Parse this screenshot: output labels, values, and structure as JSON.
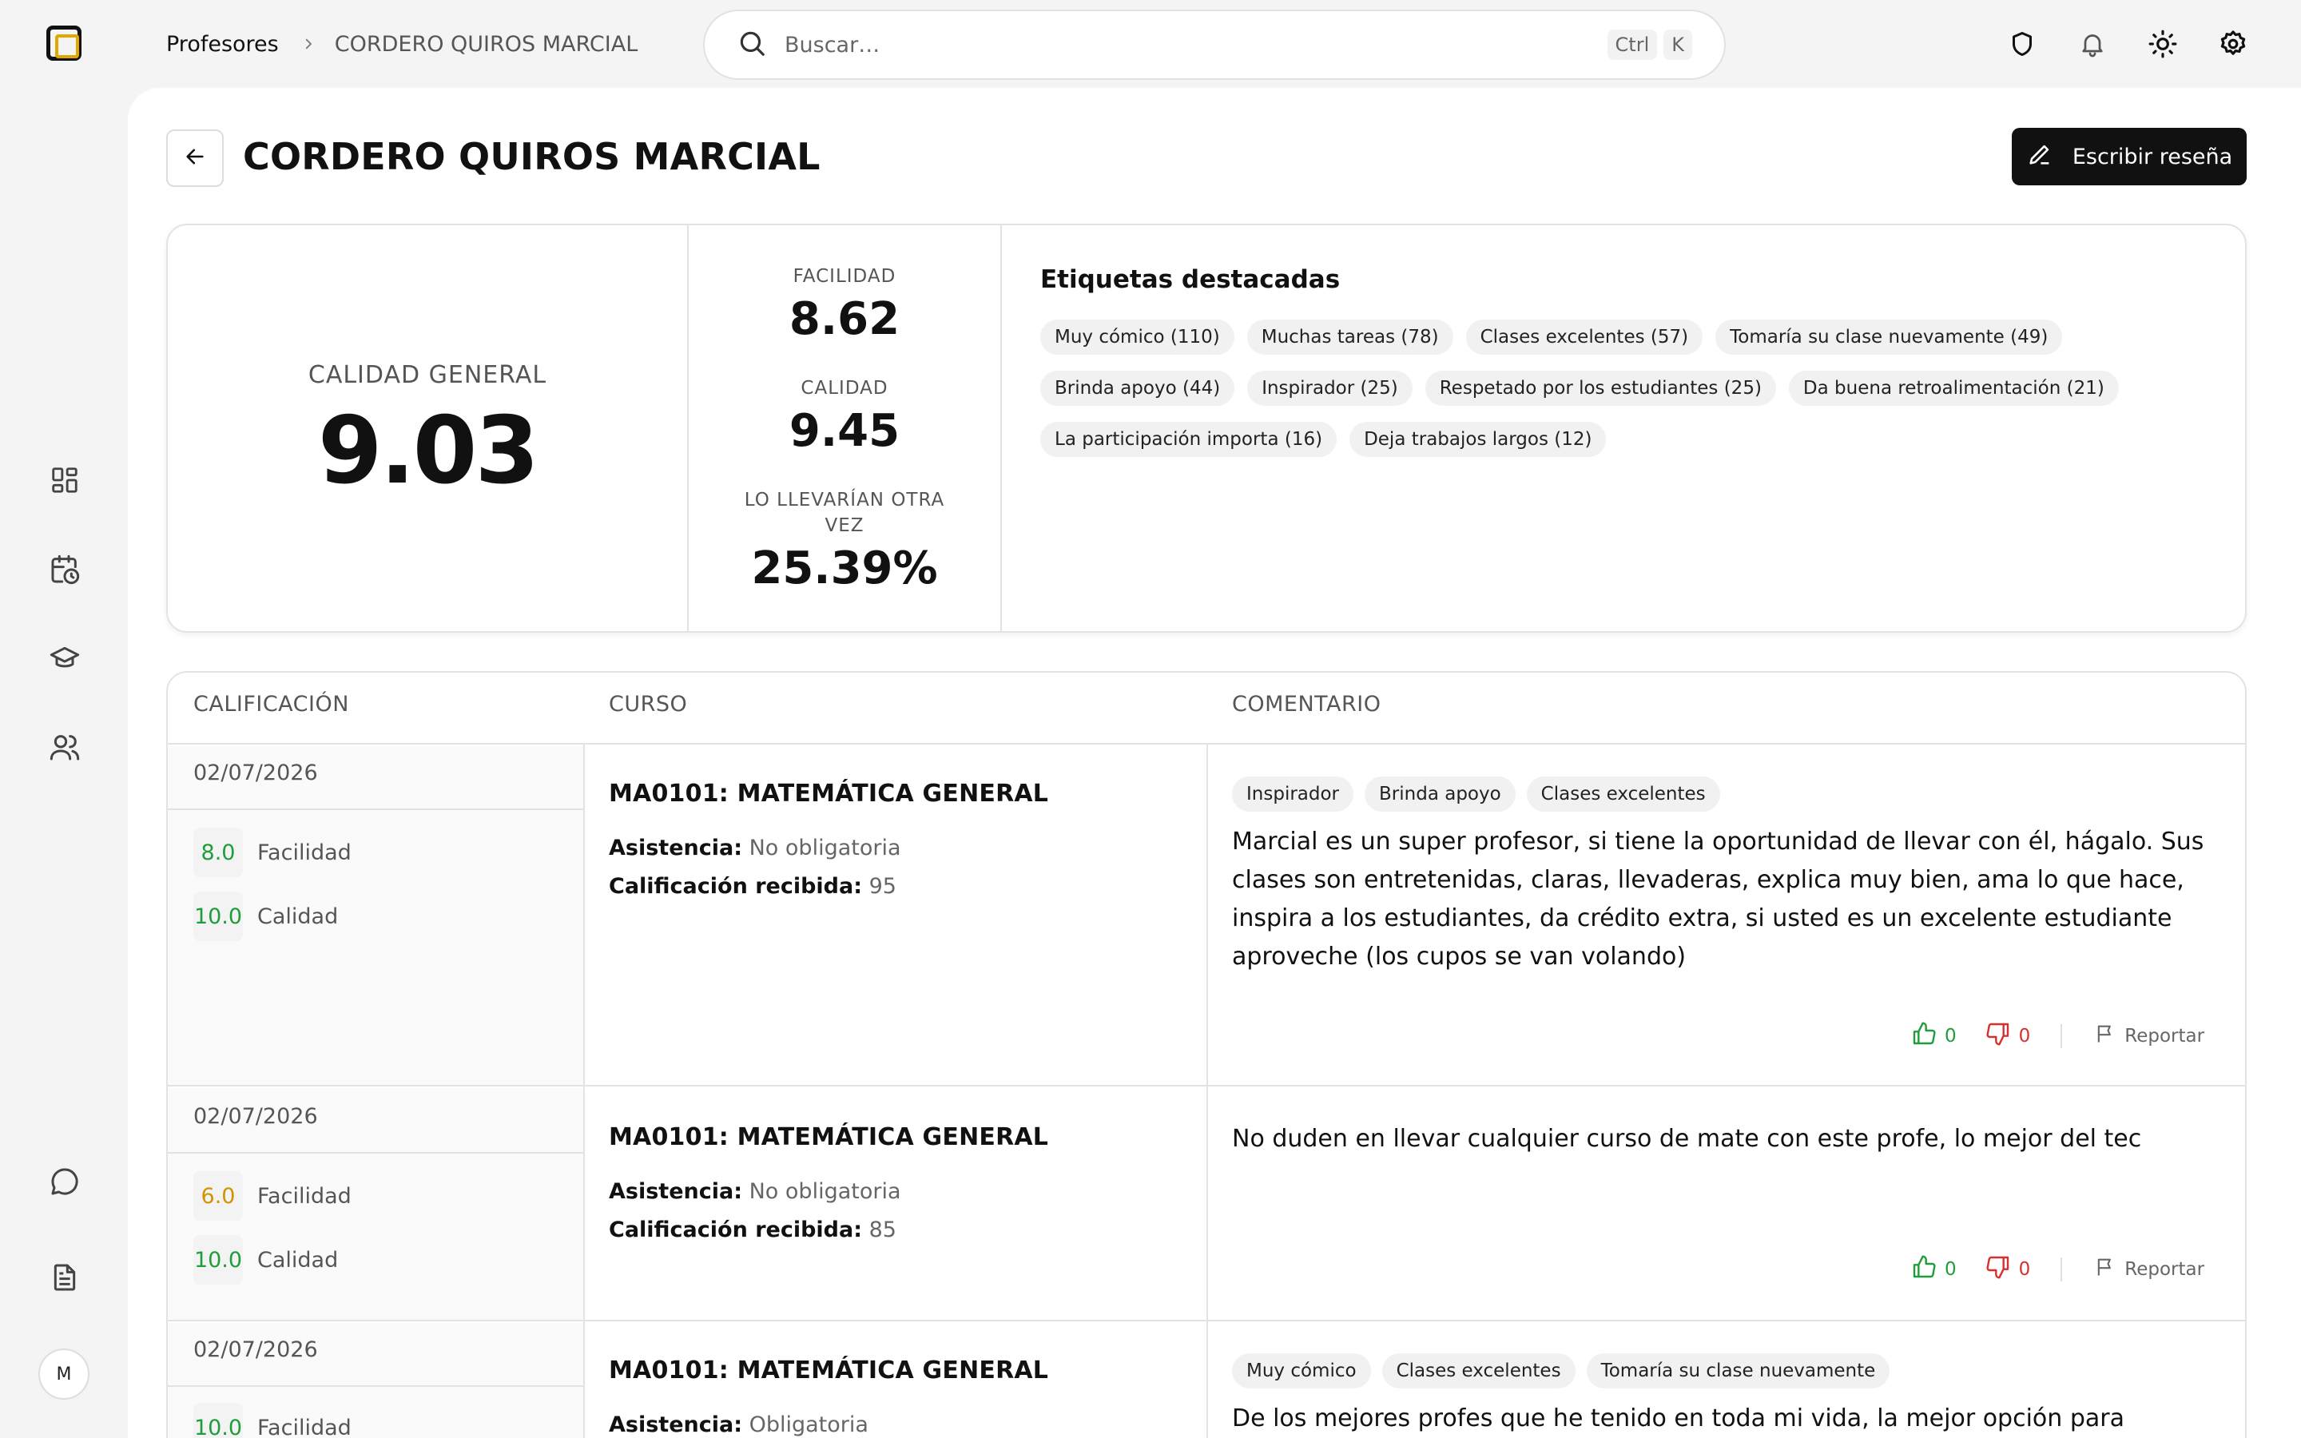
{
  "breadcrumb": {
    "root": "Profesores",
    "current": "CORDERO QUIROS MARCIAL"
  },
  "search": {
    "placeholder": "Buscar…",
    "kbd1": "Ctrl",
    "kbd2": "K"
  },
  "topbar_icons": [
    "shield-icon",
    "bell-icon",
    "sun-icon",
    "gear-icon"
  ],
  "sidebar": {
    "icons": [
      "dashboard-icon",
      "calendar-clock-icon",
      "graduation-cap-icon",
      "users-icon",
      "chat-icon",
      "document-icon"
    ],
    "avatar": "M"
  },
  "page": {
    "title": "CORDERO QUIROS MARCIAL",
    "write_review": "Escribir reseña"
  },
  "summary": {
    "overall_label": "CALIDAD GENERAL",
    "overall_value": "9.03",
    "facilidad_label": "FACILIDAD",
    "facilidad_value": "8.62",
    "calidad_label": "CALIDAD",
    "calidad_value": "9.45",
    "retake_label": "LO LLEVARÍAN OTRA VEZ",
    "retake_value": "25.39%",
    "tags_title": "Etiquetas destacadas",
    "tags": [
      "Muy cómico (110)",
      "Muchas tareas (78)",
      "Clases excelentes (57)",
      "Tomaría su clase nuevamente (49)",
      "Brinda apoyo (44)",
      "Inspirador (25)",
      "Respetado por los estudiantes (25)",
      "Da buena retroalimentación (21)",
      "La participación importa (16)",
      "Deja trabajos largos (12)"
    ]
  },
  "table": {
    "headers": {
      "rating": "CALIFICACIÓN",
      "course": "CURSO",
      "comment": "COMENTARIO"
    },
    "labels": {
      "facilidad": "Facilidad",
      "calidad": "Calidad",
      "asistencia": "Asistencia:",
      "calificacion": "Calificación recibida:",
      "report": "Reportar"
    },
    "reviews": [
      {
        "date": "02/07/2026",
        "facilidad": "8.0",
        "calidad": "10.0",
        "course": "MA0101: MATEMÁTICA GENERAL",
        "asistencia": "No obligatoria",
        "calificacion": "95",
        "tags": [
          "Inspirador",
          "Brinda apoyo",
          "Clases excelentes"
        ],
        "comment": "Marcial es un super profesor, si tiene la oportunidad de llevar con él, hágalo. Sus clases son entretenidas, claras, llevaderas, explica muy bien, ama lo que hace, inspira a los estudiantes, da crédito extra, si usted es un excelente estudiante aproveche (los cupos se van volando)",
        "likes": "0",
        "dislikes": "0"
      },
      {
        "date": "02/07/2026",
        "facilidad": "6.0",
        "calidad": "10.0",
        "course": "MA0101: MATEMÁTICA GENERAL",
        "asistencia": "No obligatoria",
        "calificacion": "85",
        "tags": [],
        "comment": "No duden en llevar cualquier curso de mate con este profe, lo mejor del tec",
        "likes": "0",
        "dislikes": "0"
      },
      {
        "date": "02/07/2026",
        "facilidad": "10.0",
        "course": "MA0101: MATEMÁTICA GENERAL",
        "asistencia": "Obligatoria",
        "tags": [
          "Muy cómico",
          "Clases excelentes",
          "Tomaría su clase nuevamente"
        ],
        "comment": "De los mejores profes que he tenido en toda mi vida, la mejor opción para matricular"
      }
    ]
  },
  "colors": {
    "good": "#1f9d3a",
    "medium": "#d19400",
    "bad": "#d62f2f",
    "logo_accent": "#e0a800"
  }
}
